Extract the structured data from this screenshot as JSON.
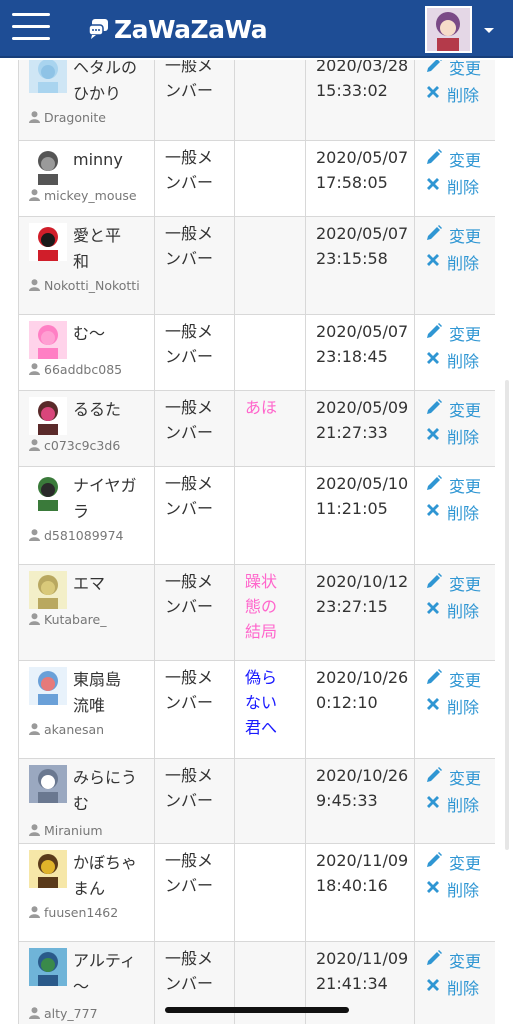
{
  "header": {
    "app_title": "ZaWaZaWa",
    "brand_color": "#1e4d95"
  },
  "columns": [
    "user",
    "role",
    "note",
    "joined",
    "actions"
  ],
  "actions": {
    "edit_label": "変更",
    "delete_label": "削除",
    "edit_icon": "pencil-icon",
    "delete_icon": "x-icon",
    "link_color": "#2f96d3"
  },
  "members": [
    {
      "name": "ヘタルの\nひかり",
      "id": "Dragonite",
      "role": "一般メ\nンバー",
      "note": "",
      "date": "2020/03/28\n15:33:02"
    },
    {
      "name": "minny",
      "id": "mickey_mouse",
      "role": "一般メ\nンバー",
      "note": "",
      "date": "2020/05/07\n17:58:05"
    },
    {
      "name": "愛と平\n和",
      "id": "Nokotti_Nokotti",
      "role": "一般メ\nンバー",
      "note": "",
      "date": "2020/05/07\n23:15:58"
    },
    {
      "name": "む〜",
      "id": "66addbc085",
      "role": "一般メ\nンバー",
      "note": "",
      "date": "2020/05/07\n23:18:45"
    },
    {
      "name": "るるた",
      "id": "c073c9c3d6",
      "role": "一般メ\nンバー",
      "note": "あほ",
      "note_color": "#ff66cc",
      "date": "2020/05/09\n21:27:33"
    },
    {
      "name": "ナイヤガ\nラ",
      "id": "d581089974",
      "role": "一般メ\nンバー",
      "note": "",
      "date": "2020/05/10\n11:21:05"
    },
    {
      "name": "エマ",
      "id": "Kutabare_",
      "role": "一般メ\nンバー",
      "note": "躁状\n態の\n結局",
      "note_color": "#ff66cc",
      "date": "2020/10/12\n23:27:15"
    },
    {
      "name": "東扇島\n流唯",
      "id": "akanesan",
      "role": "一般メ\nンバー",
      "note": "偽ら\nない\n君へ",
      "note_color": "#1a1aff",
      "date": "2020/10/26\n0:12:10"
    },
    {
      "name": "みらにう\nむ",
      "id": "Miranium",
      "role": "一般メ\nンバー",
      "note": "",
      "date": "2020/10/26\n9:45:33"
    },
    {
      "name": "かぼちゃ\nまん",
      "id": "fuusen1462",
      "role": "一般メ\nンバー",
      "note": "",
      "date": "2020/11/09\n18:40:16"
    },
    {
      "name": "アルティ\n〜",
      "id": "alty_777",
      "role": "一般メ\nンバー",
      "note": "",
      "date": "2020/11/09\n21:41:34"
    }
  ]
}
